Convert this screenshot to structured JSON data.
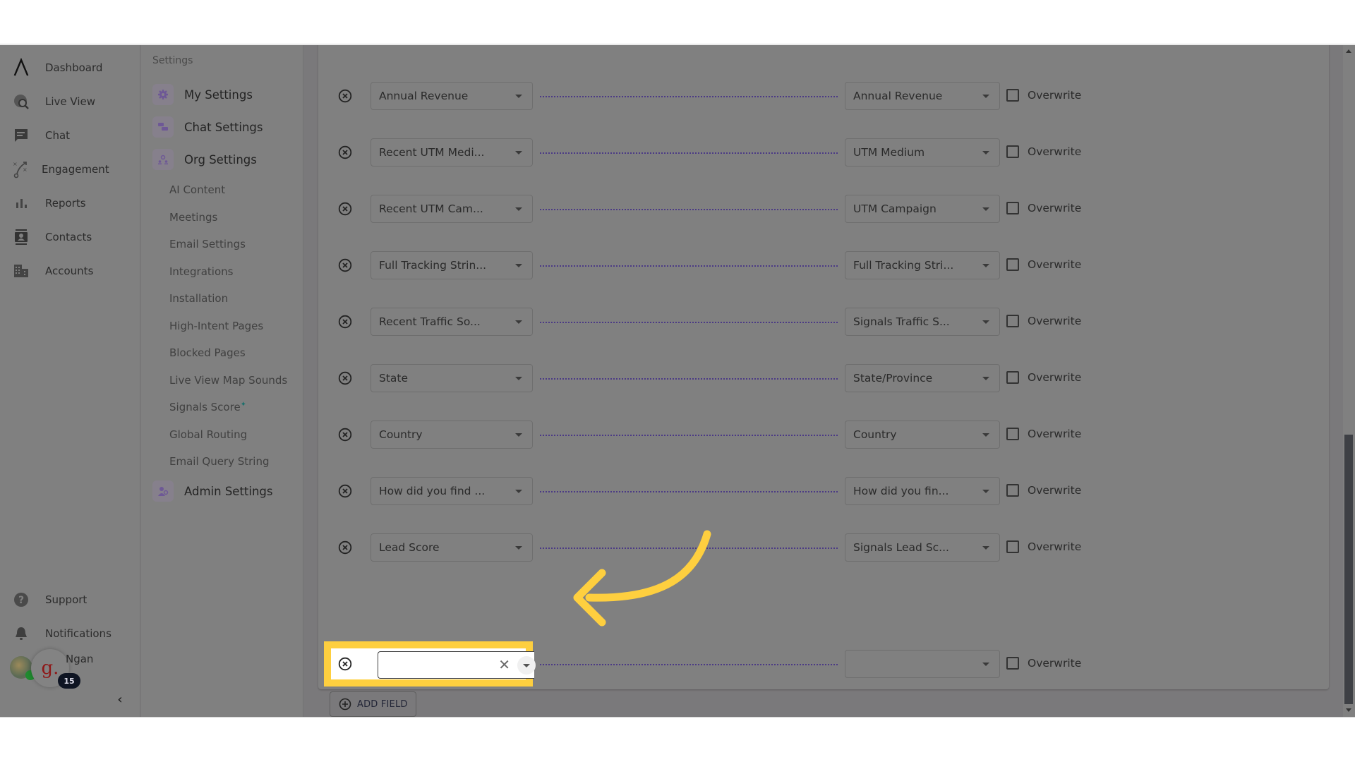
{
  "nav": {
    "items": [
      {
        "label": "Dashboard",
        "icon": "logo-caret-icon"
      },
      {
        "label": "Live View",
        "icon": "globe-search-icon"
      },
      {
        "label": "Chat",
        "icon": "chat-icon"
      },
      {
        "label": "Engagement",
        "icon": "strategy-icon"
      },
      {
        "label": "Reports",
        "icon": "bar-chart-icon"
      },
      {
        "label": "Contacts",
        "icon": "contact-card-icon"
      },
      {
        "label": "Accounts",
        "icon": "building-icon"
      }
    ],
    "bottom": [
      {
        "label": "Support",
        "icon": "help-icon"
      },
      {
        "label": "Notifications",
        "icon": "bell-icon"
      }
    ],
    "user": {
      "name": "Ngan",
      "org_initial": "g.",
      "badge_count": "15"
    },
    "collapse_glyph": "‹"
  },
  "settings": {
    "title": "Settings",
    "sections": [
      {
        "label": "My Settings",
        "icon": "gear-icon"
      },
      {
        "label": "Chat Settings",
        "icon": "chat-bubbles-icon"
      },
      {
        "label": "Org Settings",
        "icon": "org-icon"
      }
    ],
    "org_items": [
      "AI Content",
      "Meetings",
      "Email Settings",
      "Integrations",
      "Installation",
      "High-Intent Pages",
      "Blocked Pages",
      "Live View Map Sounds",
      "Signals Score",
      "Global Routing",
      "Email Query String"
    ],
    "signals_score_marker": "✦",
    "admin": {
      "label": "Admin Settings",
      "icon": "admin-icon"
    }
  },
  "mapping": {
    "overwrite_label": "Overwrite",
    "rows": [
      {
        "source": "Annual Revenue",
        "target": "Annual Revenue",
        "overwrite": false
      },
      {
        "source": "Recent UTM Medi...",
        "target": "UTM Medium",
        "overwrite": false
      },
      {
        "source": "Recent UTM Cam...",
        "target": "UTM Campaign",
        "overwrite": false
      },
      {
        "source": "Full Tracking Strin...",
        "target": "Full Tracking Stri...",
        "overwrite": false
      },
      {
        "source": "Recent Traffic So...",
        "target": "Signals Traffic S...",
        "overwrite": false
      },
      {
        "source": "State",
        "target": "State/Province",
        "overwrite": false
      },
      {
        "source": "Country",
        "target": "Country",
        "overwrite": false
      },
      {
        "source": "How did you find ...",
        "target": "How did you fin...",
        "overwrite": false
      },
      {
        "source": "Lead Score",
        "target": "Signals Lead Sc...",
        "overwrite": false
      }
    ],
    "new_row": {
      "source": "",
      "target": "",
      "overwrite": false,
      "clear_glyph": "✕"
    },
    "add_field_label": "ADD FIELD"
  },
  "colors": {
    "highlight": "#fecf3f",
    "connector": "#4b3a85",
    "accent": "#6e5896"
  }
}
